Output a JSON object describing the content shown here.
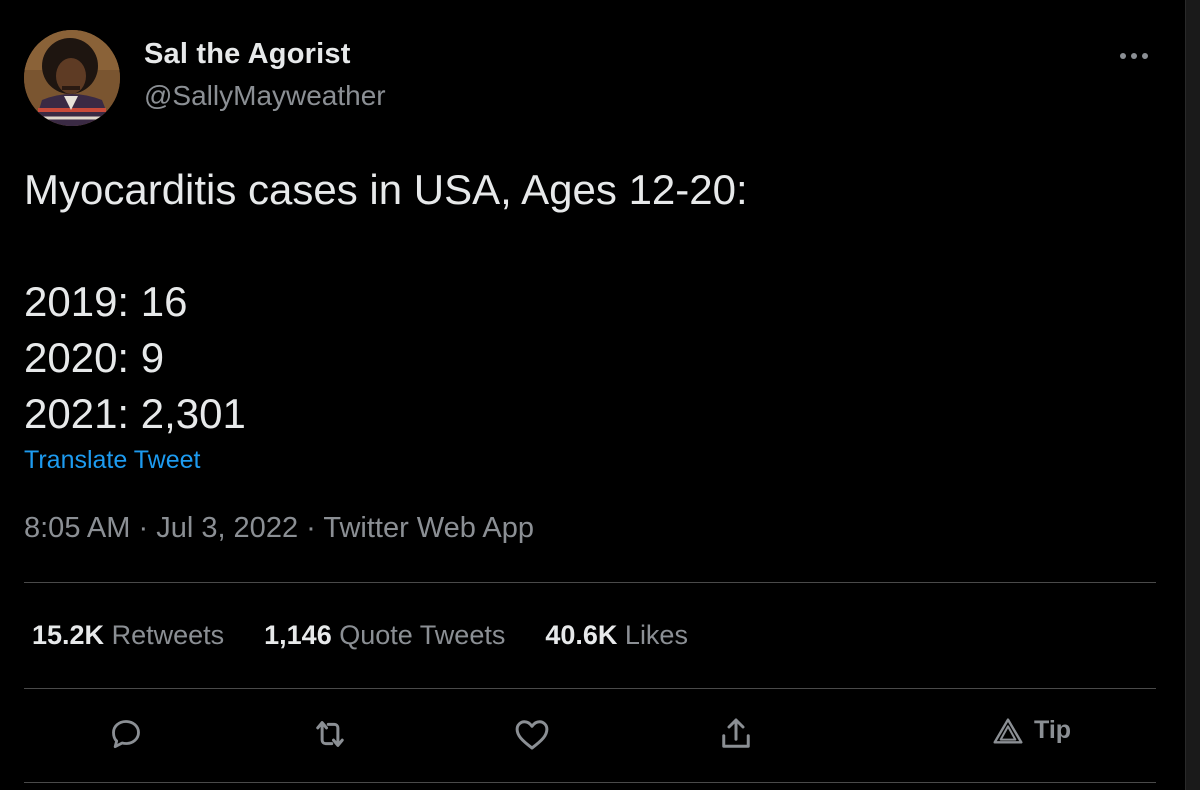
{
  "author": {
    "display_name": "Sal the Agorist",
    "handle": "@SallyMayweather"
  },
  "tweet": {
    "lines": [
      "Myocarditis cases in USA, Ages 12-20:",
      "",
      "2019: 16",
      "2020: 9",
      "2021: 2,301"
    ],
    "translate_label": "Translate Tweet",
    "time": "8:05 AM",
    "date": "Jul 3, 2022",
    "source": "Twitter Web App"
  },
  "stats": {
    "retweets_count": "15.2K",
    "retweets_label": "Retweets",
    "quotes_count": "1,146",
    "quotes_label": "Quote Tweets",
    "likes_count": "40.6K",
    "likes_label": "Likes"
  },
  "actions": {
    "reply_icon": "reply-icon",
    "retweet_icon": "retweet-icon",
    "like_icon": "heart-icon",
    "share_icon": "share-icon",
    "tip_label": "Tip"
  },
  "colors": {
    "background": "#000000",
    "text": "#e7e9ea",
    "secondary": "#8b8f94",
    "link": "#1d9bf0"
  }
}
